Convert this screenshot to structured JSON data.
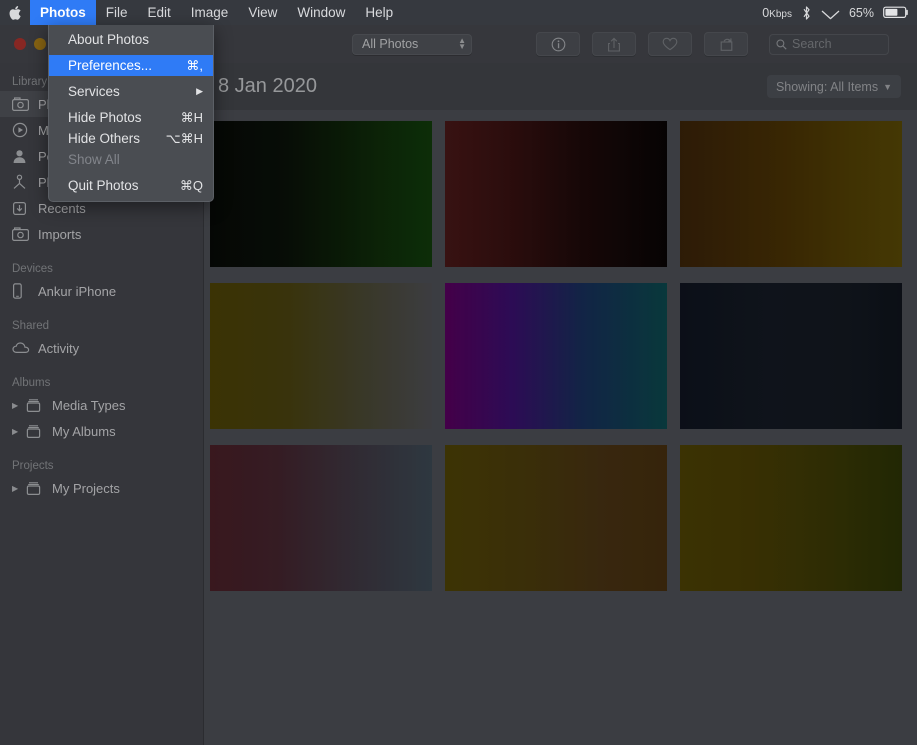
{
  "menubar": {
    "apple_icon": "apple-logo-icon",
    "items": [
      {
        "label": "Photos",
        "active": true,
        "bold": true
      },
      {
        "label": "File",
        "active": false,
        "bold": false
      },
      {
        "label": "Edit",
        "active": false,
        "bold": false
      },
      {
        "label": "Image",
        "active": false,
        "bold": false
      },
      {
        "label": "View",
        "active": false,
        "bold": false
      },
      {
        "label": "Window",
        "active": false,
        "bold": false
      },
      {
        "label": "Help",
        "active": false,
        "bold": false
      }
    ],
    "status": {
      "network_speed": "0",
      "network_unit": "Kbps",
      "bluetooth_icon": "bluetooth-icon",
      "wifi_icon": "wifi-icon",
      "battery_percent": "65%",
      "battery_icon": "battery-icon"
    }
  },
  "dropdown": {
    "items": [
      {
        "label": "About Photos",
        "shortcut": "",
        "highlight": false,
        "disabled": false,
        "submenu": false
      },
      {
        "label": "Preferences...",
        "shortcut": "⌘,",
        "highlight": true,
        "disabled": false,
        "submenu": false
      },
      {
        "label": "Services",
        "shortcut": "",
        "highlight": false,
        "disabled": false,
        "submenu": true
      },
      {
        "label": "Hide Photos",
        "shortcut": "⌘H",
        "highlight": false,
        "disabled": false,
        "submenu": false
      },
      {
        "label": "Hide Others",
        "shortcut": "⌥⌘H",
        "highlight": false,
        "disabled": false,
        "submenu": false
      },
      {
        "label": "Show All",
        "shortcut": "",
        "highlight": false,
        "disabled": true,
        "submenu": false
      },
      {
        "label": "Quit Photos",
        "shortcut": "⌘Q",
        "highlight": false,
        "disabled": false,
        "submenu": false
      }
    ]
  },
  "toolbar": {
    "sidebar_toggle_icon": "sidebar-toggle-icon",
    "view_popup": {
      "value": "All Photos"
    },
    "buttons": [
      {
        "name": "info-button",
        "icon": "info-icon",
        "dim": false
      },
      {
        "name": "share-button",
        "icon": "share-icon",
        "dim": true
      },
      {
        "name": "favorite-button",
        "icon": "heart-icon",
        "dim": true
      },
      {
        "name": "rotate-button",
        "icon": "rotate-icon",
        "dim": true
      }
    ],
    "search": {
      "placeholder": "Search",
      "value": "",
      "icon": "search-icon"
    }
  },
  "sidebar": {
    "sections": [
      {
        "header": "Library",
        "rows": [
          {
            "label": "Photos",
            "icon": "photos-icon",
            "selected": true,
            "disclosure": false
          },
          {
            "label": "Memories",
            "icon": "memories-icon",
            "selected": false,
            "disclosure": false
          },
          {
            "label": "People",
            "icon": "people-icon",
            "selected": false,
            "disclosure": false
          },
          {
            "label": "Places",
            "icon": "places-icon",
            "selected": false,
            "disclosure": false
          },
          {
            "label": "Recents",
            "icon": "recents-icon",
            "selected": false,
            "disclosure": false
          },
          {
            "label": "Imports",
            "icon": "imports-icon",
            "selected": false,
            "disclosure": false
          }
        ]
      },
      {
        "header": "Devices",
        "rows": [
          {
            "label": "Ankur iPhone",
            "icon": "iphone-icon",
            "selected": false,
            "disclosure": false
          }
        ]
      },
      {
        "header": "Shared",
        "rows": [
          {
            "label": "Activity",
            "icon": "cloud-icon",
            "selected": false,
            "disclosure": false
          }
        ]
      },
      {
        "header": "Albums",
        "rows": [
          {
            "label": "Media Types",
            "icon": "album-icon",
            "selected": false,
            "disclosure": true
          },
          {
            "label": "My Albums",
            "icon": "album-icon",
            "selected": false,
            "disclosure": true
          }
        ]
      },
      {
        "header": "Projects",
        "rows": [
          {
            "label": "My Projects",
            "icon": "album-icon",
            "selected": false,
            "disclosure": true
          }
        ]
      }
    ]
  },
  "content": {
    "date_header": "8 Jan 2020",
    "showing_label": "Showing: All Items",
    "showing_chevron_icon": "chevron-down-icon",
    "thumbnails": [
      {
        "name": "photo-thumbnail-1",
        "gradient": "linear-gradient(90deg, #070a07 0%, #0a1208 35%, #0f2a0a 70%, #123d0b 100%)"
      },
      {
        "name": "photo-thumbnail-2",
        "gradient": "linear-gradient(90deg, #4a1818 0%, #3a1212 28%, #1e0a0a 62%, #090505 100%)"
      },
      {
        "name": "photo-thumbnail-3",
        "gradient": "linear-gradient(90deg, #3c2409 0%, #4a3205 45%, #544105 75%, #5a4a06 100%)"
      },
      {
        "name": "photo-thumbnail-4",
        "gradient": "linear-gradient(90deg, #4e4406 0%, #4b4410 35%, #4c4a36 70%, #4f5055 100%)"
      },
      {
        "name": "photo-thumbnail-5",
        "gradient": "linear-gradient(90deg, #5a0060 0%, #3b1070 30%, #18305c 62%, #0c4a4e 100%)"
      },
      {
        "name": "photo-thumbnail-6",
        "gradient": "linear-gradient(90deg, #101520 0%, #141a24 40%, #141922 75%, #10151d 100%)"
      },
      {
        "name": "photo-thumbnail-7",
        "gradient": "linear-gradient(90deg, #4b2028 0%, #46252f 30%, #413641 60%, #3d4a55 100%)"
      },
      {
        "name": "photo-thumbnail-8",
        "gradient": "linear-gradient(90deg, #504406 0%, #4d3e0c 35%, #4a3414 70%, #48300f 100%)"
      },
      {
        "name": "photo-thumbnail-9",
        "gradient": "linear-gradient(90deg, #4e4204 0%, #4a3f05 32%, #3d3b06 68%, #2c3406 100%)"
      }
    ]
  }
}
